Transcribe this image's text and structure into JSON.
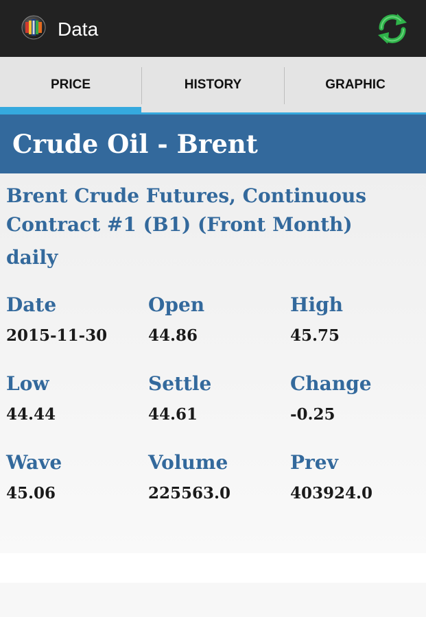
{
  "app": {
    "title": "Data",
    "icon": "app-logo-icon",
    "refresh_icon": "refresh-icon"
  },
  "tabs": [
    {
      "label": "PRICE",
      "selected": true
    },
    {
      "label": "HISTORY",
      "selected": false
    },
    {
      "label": "GRAPHIC",
      "selected": false
    }
  ],
  "instrument": {
    "name": "Crude Oil - Brent",
    "description": "Brent Crude Futures, Continuous Contract #1 (B1) (Front Month)",
    "frequency": "daily"
  },
  "fields": [
    {
      "label": "Date",
      "value": "2015-11-30"
    },
    {
      "label": "Open",
      "value": "44.86"
    },
    {
      "label": "High",
      "value": "45.75"
    },
    {
      "label": "Low",
      "value": "44.44"
    },
    {
      "label": "Settle",
      "value": "44.61"
    },
    {
      "label": "Change",
      "value": "-0.25"
    },
    {
      "label": "Wave",
      "value": "45.06"
    },
    {
      "label": "Volume",
      "value": "225563.0"
    },
    {
      "label": "Prev",
      "value": "403924.0"
    }
  ],
  "colors": {
    "action_bar": "#222222",
    "accent": "#35a9de",
    "header": "#33699c",
    "label_text": "#33699c",
    "value_text": "#1a1a1a",
    "refresh_green": "#2fb34a"
  }
}
